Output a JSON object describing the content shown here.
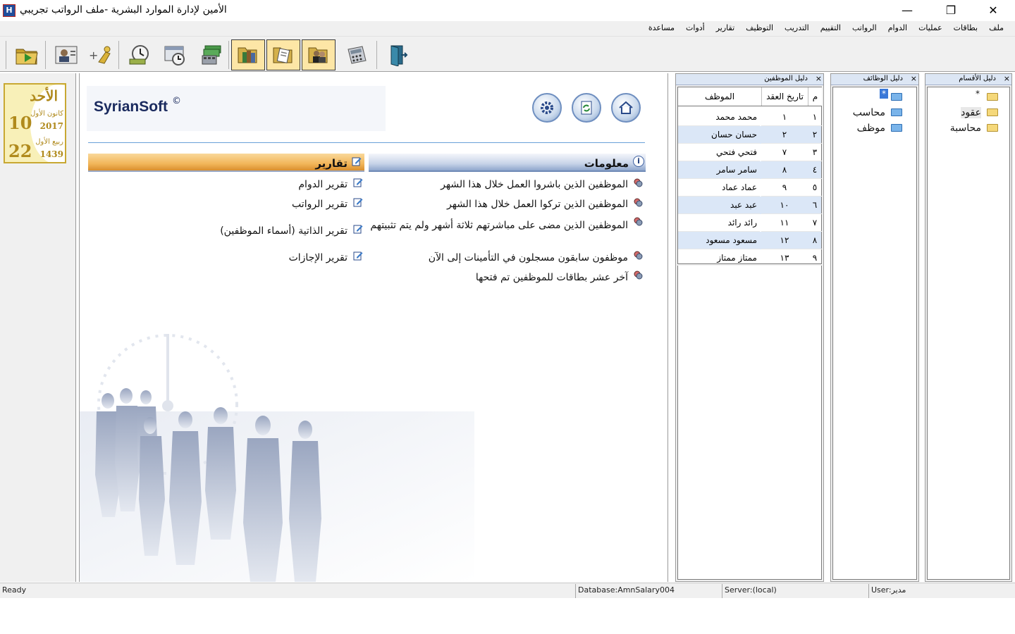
{
  "window": {
    "title": "الأمين لإدارة الموارد البشرية -ملف الرواتب تجريبي",
    "app_icon_letter": "H",
    "controls": {
      "minimize": "—",
      "restore": "❐",
      "close": "✕"
    }
  },
  "menu": [
    {
      "label": "ملف"
    },
    {
      "label": "بطاقات"
    },
    {
      "label": "عمليات"
    },
    {
      "label": "الدوام"
    },
    {
      "label": "الرواتب"
    },
    {
      "label": "التقييم"
    },
    {
      "label": "التدريب"
    },
    {
      "label": "التوظيف"
    },
    {
      "label": "تقارير"
    },
    {
      "label": "أدوات"
    },
    {
      "label": "مساعدة"
    }
  ],
  "toolbar": {
    "buttons": [
      {
        "icon": "open-folder-icon"
      },
      {
        "icon": "employee-card-icon"
      },
      {
        "icon": "add-employee-icon"
      },
      {
        "icon": "attendance-clock-icon"
      },
      {
        "icon": "schedule-icon"
      },
      {
        "icon": "salaries-money-icon"
      },
      {
        "icon": "books-icon"
      },
      {
        "icon": "documents-icon"
      },
      {
        "icon": "employees-icon"
      },
      {
        "icon": "calculator-icon"
      },
      {
        "icon": "exit-door-icon"
      }
    ]
  },
  "date_panel": {
    "weekday": "الأحد",
    "gregorian_day": "10",
    "gregorian_month": "كانون الأول",
    "gregorian_year": "2017",
    "hijri_day": "22",
    "hijri_month": "ربيع الأول",
    "hijri_year": "1439"
  },
  "main": {
    "brand": "SyrianSoft",
    "brand_mark": "©",
    "nav_buttons": [
      {
        "icon": "settings-gear-icon"
      },
      {
        "icon": "refresh-icon"
      },
      {
        "icon": "home-icon"
      }
    ],
    "info": {
      "title": "معلومات",
      "icon": "i",
      "links": [
        "الموظفين الذين باشروا العمل خلال هذا الشهر",
        "الموظفين الذين تركوا العمل خلال هذا الشهر",
        "الموظفين الذين مضى على مباشرتهم ثلاثة أشهر ولم يتم تثبيتهم",
        "موظفون سابقون مسجلون في التأمينات إلى الآن",
        "آخر عشر بطاقات للموظفين تم فتحها"
      ]
    },
    "reports": {
      "title": "تقارير",
      "links": [
        "تقرير الدوام",
        "تقرير الرواتب",
        "تقرير الذاتية (أسماء الموظفين)",
        "تقرير الإجازات"
      ]
    }
  },
  "panes": {
    "employees": {
      "title": "دليل الموظفين",
      "close": "×",
      "columns": [
        "م",
        "تاريخ العقد",
        "الموظف"
      ],
      "rows": [
        {
          "n": "١",
          "contract": "١",
          "name": "محمد محمد"
        },
        {
          "n": "٢",
          "contract": "٢",
          "name": "حسان حسان"
        },
        {
          "n": "٣",
          "contract": "٧",
          "name": "فتحي فتحي"
        },
        {
          "n": "٤",
          "contract": "٨",
          "name": "سامر سامر"
        },
        {
          "n": "٥",
          "contract": "٩",
          "name": "عماد عماد"
        },
        {
          "n": "٦",
          "contract": "١٠",
          "name": "عبد عبد"
        },
        {
          "n": "٧",
          "contract": "١١",
          "name": "رائد رائد"
        },
        {
          "n": "٨",
          "contract": "١٢",
          "name": "مسعود مسعود"
        },
        {
          "n": "٩",
          "contract": "١٣",
          "name": "ممتاز ممتاز"
        }
      ]
    },
    "jobs": {
      "title": "دليل الوظائف",
      "close": "×",
      "items": [
        "*",
        "محاسب",
        "موظف"
      ]
    },
    "departments": {
      "title": "دليل الأقسام",
      "close": "×",
      "items": [
        "*",
        "عقود",
        "محاسبة"
      ]
    }
  },
  "status": {
    "ready": "Ready",
    "database": "Database:AmnSalary004",
    "server": "Server:(local)",
    "user": "User:مدير"
  }
}
